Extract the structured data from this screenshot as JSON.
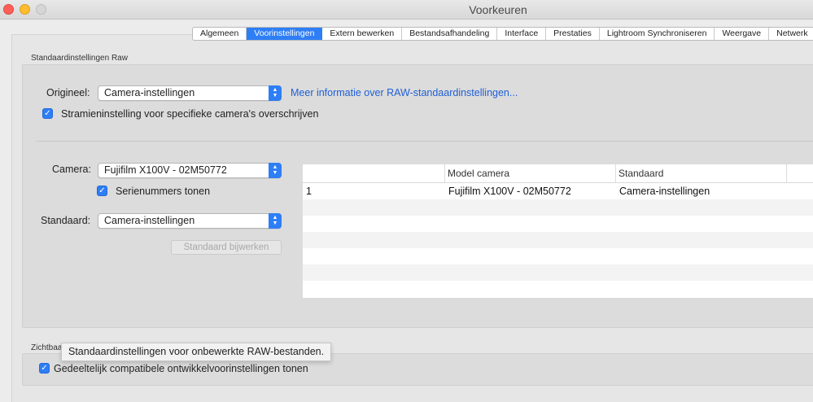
{
  "window": {
    "title": "Voorkeuren"
  },
  "tabs": [
    {
      "label": "Algemeen",
      "active": false
    },
    {
      "label": "Voorinstellingen",
      "active": true
    },
    {
      "label": "Extern bewerken",
      "active": false
    },
    {
      "label": "Bestandsafhandeling",
      "active": false
    },
    {
      "label": "Interface",
      "active": false
    },
    {
      "label": "Prestaties",
      "active": false
    },
    {
      "label": "Lightroom Synchroniseren",
      "active": false
    },
    {
      "label": "Weergave",
      "active": false
    },
    {
      "label": "Netwerk",
      "active": false
    }
  ],
  "raw": {
    "group_label": "Standaardinstellingen Raw",
    "origineel_label": "Origineel:",
    "origineel_value": "Camera-instellingen",
    "info_link": "Meer informatie over RAW-standaardinstellingen...",
    "override_checkbox": "Stramieninstelling voor specifieke camera's overschrijven",
    "camera_label": "Camera:",
    "camera_value": "Fujifilm X100V - 02M50772",
    "serial_checkbox": "Serienummers tonen",
    "standaard_label": "Standaard:",
    "standaard_value": "Camera-instellingen",
    "update_button": "Standaard bijwerken"
  },
  "table": {
    "headers": [
      "",
      "Model camera",
      "Standaard",
      ""
    ],
    "rows": [
      [
        "1",
        "Fujifilm X100V - 02M50772",
        "Camera-instellingen"
      ]
    ]
  },
  "visibility": {
    "group_label": "Zichtbaa",
    "checkbox": "Gedeeltelijk compatibele ontwikkelvoorinstellingen tonen"
  },
  "tooltip": "Standaardinstellingen voor onbewerkte RAW-bestanden.",
  "colors": {
    "accent": "#2e7ef5",
    "link": "#1f5fd6"
  }
}
